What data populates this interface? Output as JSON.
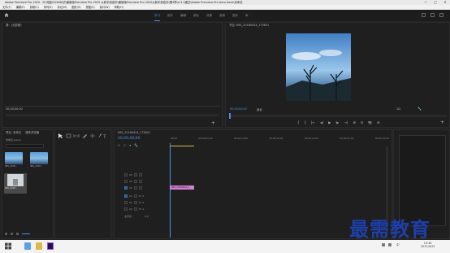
{
  "window": {
    "title": "Adobe Premiere Pro 2020 - D:\\电影\\52606\\仿\\最新版Premiere Pro 2020 从新手到高手\\最新版Premiere Pro 2020从新手到高手\\第4章\\4.3.1通过\\Adobe Premiere Pro Auto-Save\\未命名",
    "controls": [
      "—",
      "□",
      "✕"
    ]
  },
  "menu": [
    "文件(F)",
    "编辑(E)",
    "剪辑(C)",
    "序列(S)",
    "标记(M)",
    "图形(G)",
    "视图(V)",
    "窗口(W)",
    "帮助(H)"
  ],
  "workspace_tabs": [
    "学习",
    "组件",
    "编辑",
    "颜色",
    "效果",
    "音频",
    "图形",
    "库"
  ],
  "source_monitor": {
    "title": "源：(无剪辑)",
    "timecode": "00;00;00;00"
  },
  "program_monitor": {
    "title": "节目: IMG_20180424_173601",
    "timecode": "00;00;00;00",
    "fit": "适合",
    "end_timecode": "1/2",
    "buttons": [
      "{",
      "}",
      "|←",
      "◄|",
      "▶",
      "|►",
      "→|",
      "⊞",
      "⊟",
      "📷",
      "⊞",
      "+"
    ]
  },
  "project_panel": {
    "tabs": [
      "项目: 未命名",
      "媒体浏览器"
    ],
    "project_file": "未命名.prproj",
    "items": [
      {
        "label": "IMG_2018...",
        "duration": "5;00"
      },
      {
        "label": "IMG_2018...",
        "duration": "5;00"
      },
      {
        "label": "IMG_2018...",
        "duration": "5;00"
      }
    ]
  },
  "timeline": {
    "sequence_tab": "IMG_20180424_173601",
    "timecode": "00;00;00;00",
    "ruler": [
      ":00;00",
      "00;00;05;00",
      "00;00;10;00",
      "00;00;15;00",
      "00;00;20;00",
      "00;00;25;00",
      "00;00;30;00"
    ],
    "video_tracks": [
      "V3",
      "V2",
      "V1"
    ],
    "audio_tracks": [
      "A1",
      "A2",
      "A3"
    ],
    "master_label": "主声道",
    "master_value": "0.0",
    "clip_label": "IMG_20180424_1"
  },
  "taskbar": {
    "time": "15:44",
    "date": "2021/4/22",
    "lang": "中"
  },
  "watermark": "最需教育",
  "colors": {
    "accent": "#4f8ee8",
    "clip": "#d47fd6",
    "work_area": "#d4b84a"
  }
}
